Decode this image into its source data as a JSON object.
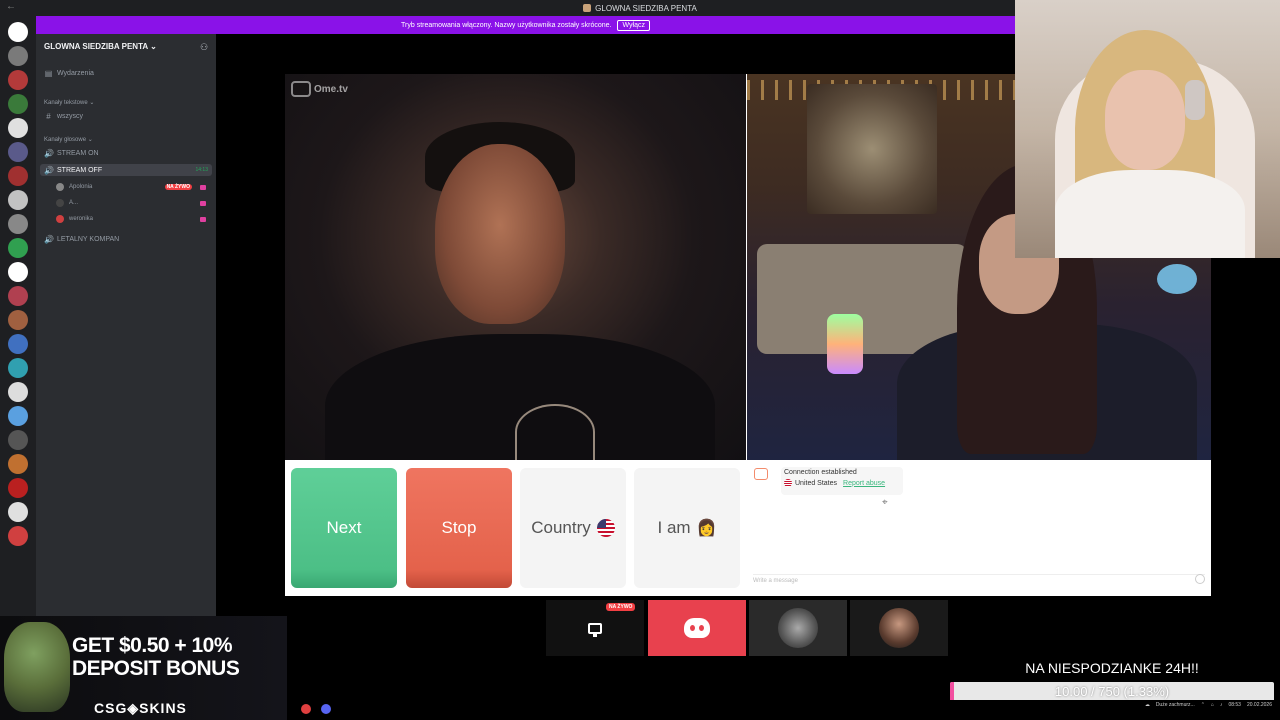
{
  "titlebar": {
    "title": "GLOWNA SIEDZIBA PENTA",
    "back_glyph": "←"
  },
  "banner": {
    "text": "Tryb streamowania włączony. Nazwy użytkownika zostały skrócone.",
    "button": "Wyłącz",
    "color": "#8a12e8"
  },
  "rail": {
    "servers": [
      {
        "color": "#ffffff",
        "badge": ""
      },
      {
        "color": "#7a7a7a",
        "badge": ""
      },
      {
        "color": "#b33a3a",
        "badge": ""
      },
      {
        "color": "#3a7a3a",
        "badge": ""
      },
      {
        "color": "#e0e0e0",
        "badge": ""
      },
      {
        "color": "#5a5a8a",
        "badge": ""
      },
      {
        "color": "#a03030",
        "badge": ""
      },
      {
        "color": "#c2c2c2",
        "badge": ""
      },
      {
        "color": "#888888",
        "badge": ""
      },
      {
        "color": "#30a050",
        "badge": ""
      },
      {
        "color": "#ffffff",
        "badge": ""
      },
      {
        "color": "#b04050",
        "badge": ""
      },
      {
        "color": "#a06040",
        "badge": ""
      },
      {
        "color": "#4070c0",
        "badge": ""
      },
      {
        "color": "#30a0b0",
        "badge": ""
      },
      {
        "color": "#dddddd",
        "badge": ""
      },
      {
        "color": "#5aa0e0",
        "badge": ""
      },
      {
        "color": "#555555",
        "badge": ""
      },
      {
        "color": "#c07030",
        "badge": ""
      },
      {
        "color": "#ba2020",
        "badge": ""
      },
      {
        "color": "#e0e0e0",
        "badge": ""
      },
      {
        "color": "#d04040",
        "badge": ""
      }
    ]
  },
  "sidebar": {
    "server_name": "GLOWNA SIEDZIBA PENTA",
    "server_chevron": "⌄",
    "add_member_icon": "⚇",
    "events": {
      "icon": "▤",
      "label": "Wydarzenia"
    },
    "text_category": "Kanały tekstowe ⌄",
    "text_channels": [
      {
        "icon": "#",
        "label": "wszyscy"
      }
    ],
    "voice_category": "Kanały głosowe ⌄",
    "voice_channels": [
      {
        "icon": "🔊",
        "label": "STREAM ON"
      },
      {
        "icon": "🔊",
        "label": "STREAM OFF",
        "time": "14:13"
      },
      {
        "icon": "🔊",
        "label": "LETALNY KOMPAN"
      }
    ],
    "voice_users": [
      {
        "name": "Apolonia",
        "live": "NA ŻYWO",
        "avatar_color": "#888888"
      },
      {
        "name": "A...",
        "live": "",
        "avatar_color": "#444444"
      },
      {
        "name": "weronika",
        "live": "",
        "avatar_color": "#d04040"
      }
    ]
  },
  "ome": {
    "logo": "Ome.tv",
    "buttons": {
      "next": "Next",
      "stop": "Stop",
      "country": "Country",
      "iam": "I am",
      "iam_emoji": "👩"
    },
    "chat": {
      "status": "Connection established",
      "country": "United States",
      "report": "Report abuse",
      "placeholder": "Write a message"
    }
  },
  "dock": {
    "live_badge": "NA ŻYWO"
  },
  "ad": {
    "line1": "GET $0.50 + 10%",
    "line2": "DEPOSIT BONUS",
    "brand": "CSG◈SKINS"
  },
  "goal": {
    "title": "NA NIESPODZIANKE 24H!!",
    "progress_text": "10.00 / 750 (1.33%)",
    "progress_fraction": 0.0133,
    "fill_color": "#f24ea0"
  },
  "taskbar": {
    "weather": "Duże zachmurz...",
    "time": "08:53",
    "date": "20.02.2026"
  }
}
